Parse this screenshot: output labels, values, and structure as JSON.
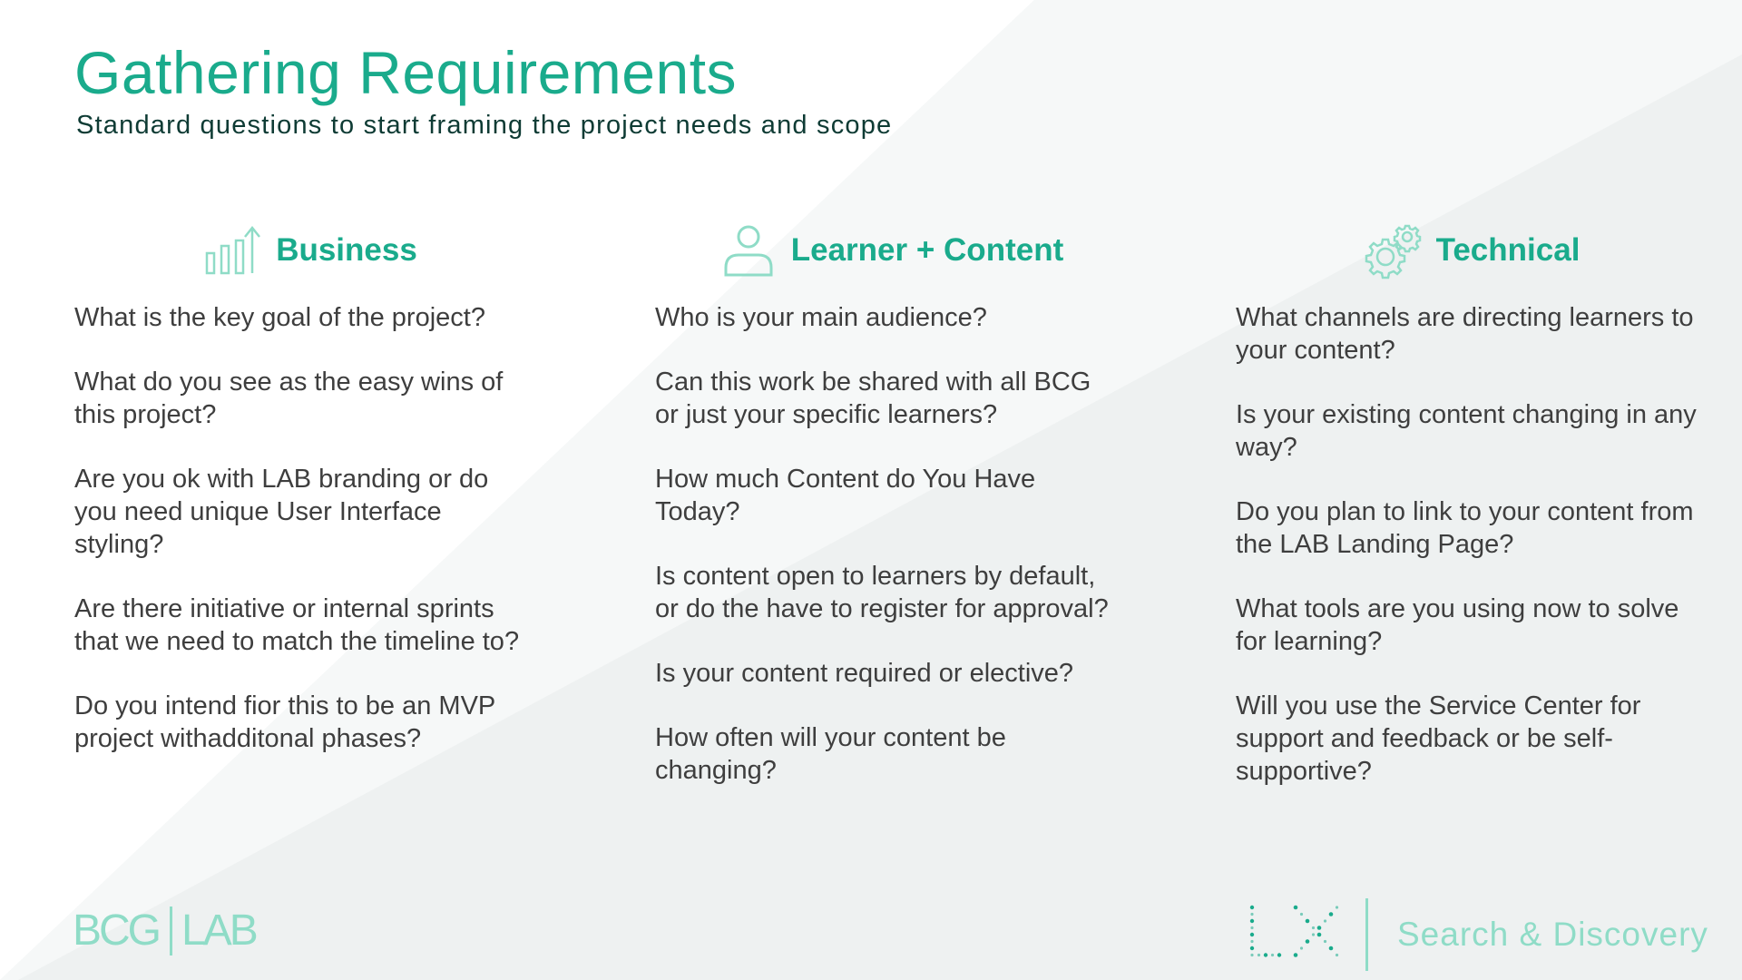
{
  "header": {
    "title": "Gathering Requirements",
    "subtitle": "Standard questions to start framing the project needs and scope"
  },
  "columns": [
    {
      "heading": "Business",
      "icon": "bar-chart-growth-icon",
      "questions": [
        "What is the key goal of the project?",
        "What do you see as the easy wins of this project?",
        "Are you ok with LAB branding or do you need unique User Interface styling?",
        "Are there initiative or internal sprints that we need to match the timeline to?",
        "Do you intend fior this to be an MVP project withadditonal phases?"
      ]
    },
    {
      "heading": "Learner + Content",
      "icon": "person-icon",
      "questions": [
        "Who is your main audience?",
        "Can this work be shared with all BCG or just your specific learners?",
        "How much Content do You Have Today?",
        "Is content open to learners by default, or do the have to register for approval?",
        "Is your content required or elective?",
        "How often will your content be changing?"
      ]
    },
    {
      "heading": "Technical",
      "icon": "gears-icon",
      "questions": [
        "What channels are directing learners to your content?",
        "Is your existing content changing in any way?",
        "Do you plan to link to your content from the LAB Landing Page?",
        "What tools are you using now to solve for learning?",
        "Will you use the Service Center for support and feedback or be self-supportive?"
      ]
    }
  ],
  "footer": {
    "brand_left": "BCG",
    "brand_right": "LAB",
    "product_mark": "LX",
    "product_name": "Search & Discovery"
  },
  "colors": {
    "accent": "#1aab8c",
    "accent_light": "#8fdcc7",
    "subtitle": "#0e3b34",
    "body_text": "#3e3e3e"
  }
}
